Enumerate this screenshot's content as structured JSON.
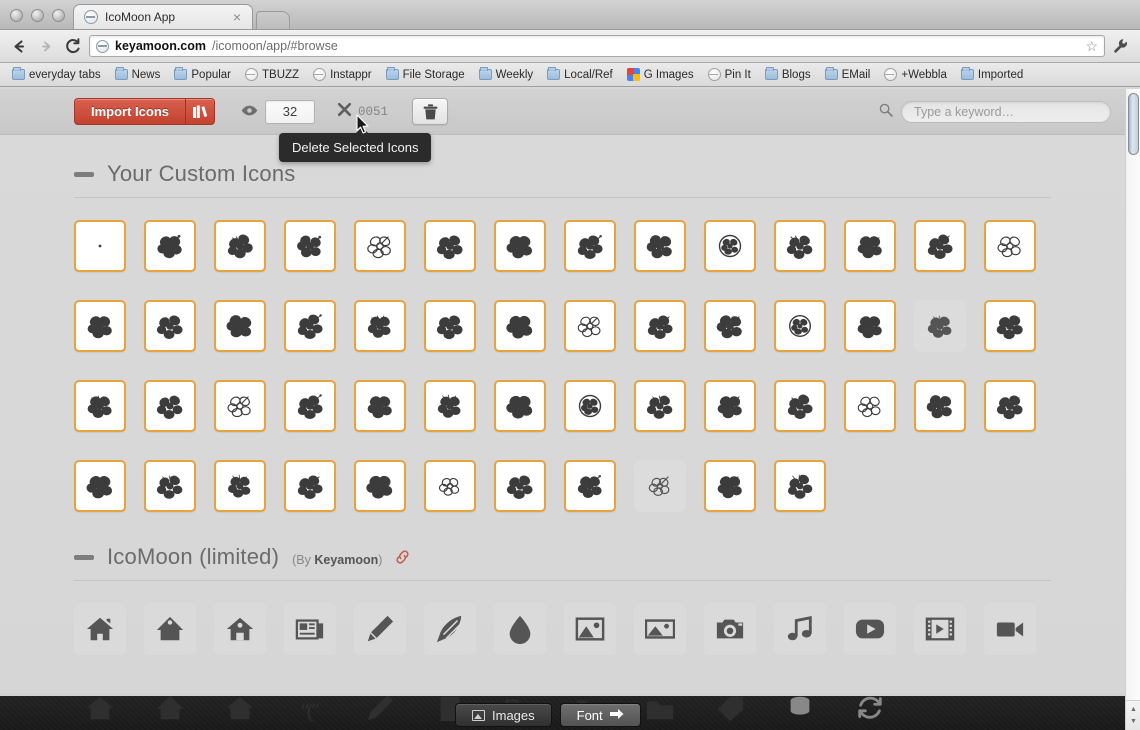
{
  "window": {
    "tab_title": "IcoMoon App",
    "tab_close": "×",
    "traffic_lights": [
      "close",
      "minimize",
      "zoom"
    ]
  },
  "navigation": {
    "back_icon": "←",
    "forward_icon": "→",
    "reload_icon": "C",
    "url_host": "keyamoon.com",
    "url_path": "/icomoon/app/#browse",
    "star_icon": "☆",
    "wrench_icon": "wrench"
  },
  "bookmarks": [
    {
      "label": "everyday tabs",
      "icon": "folder"
    },
    {
      "label": "News",
      "icon": "folder"
    },
    {
      "label": "Popular",
      "icon": "folder"
    },
    {
      "label": "TBUZZ",
      "icon": "globe"
    },
    {
      "label": "Instappr",
      "icon": "globe"
    },
    {
      "label": "File Storage",
      "icon": "folder"
    },
    {
      "label": "Weekly",
      "icon": "folder"
    },
    {
      "label": "Local/Ref",
      "icon": "folder"
    },
    {
      "label": "G Images",
      "icon": "google"
    },
    {
      "label": "Pin It",
      "icon": "globe"
    },
    {
      "label": "Blogs",
      "icon": "folder"
    },
    {
      "label": "EMail",
      "icon": "folder"
    },
    {
      "label": "+Webbla",
      "icon": "globe"
    },
    {
      "label": "Imported",
      "icon": "folder"
    }
  ],
  "toolbar": {
    "import_label": "Import Icons",
    "library_icon": "library-icon",
    "eye_icon": "eye-icon",
    "visible_count": "32",
    "x_icon": "✕",
    "hidden_count": "0051",
    "trash_icon": "trash-icon",
    "search_icon": "search-icon",
    "search_placeholder": "Type a keyword…",
    "search_value": ""
  },
  "tooltip": {
    "text": "Delete Selected Icons"
  },
  "sections": [
    {
      "title": "Your Custom Icons",
      "by": "",
      "author": "",
      "has_link": false,
      "rows": [
        {
          "cells": [
            "dot",
            "hibiscus-a",
            "hibiscus-b",
            "hibiscus-c",
            "hibiscus-outline-a",
            "hibiscus-d",
            "hibiscus-e",
            "hibiscus-f",
            "hibiscus-g",
            "hibiscus-ring",
            "hibiscus-h",
            "hibiscus-i",
            "hibiscus-j",
            "hibiscus-outline-b"
          ],
          "states": [
            "on",
            "on",
            "on",
            "on",
            "on",
            "on",
            "on",
            "on",
            "on",
            "on",
            "on",
            "on",
            "on",
            "on"
          ]
        },
        {
          "cells": [
            "hibiscus-k",
            "hibiscus-l",
            "hibiscus-m",
            "hibiscus-n",
            "hibiscus-o",
            "hibiscus-p",
            "hibiscus-q",
            "hibiscus-outline-c",
            "hibiscus-r",
            "hibiscus-s",
            "hibiscus-ring2",
            "hibiscus-t",
            "hibiscus-u",
            "hibiscus-v"
          ],
          "states": [
            "on",
            "on",
            "on",
            "on",
            "on",
            "on",
            "on",
            "on",
            "on",
            "on",
            "on",
            "on",
            "off",
            "on"
          ]
        },
        {
          "cells": [
            "hibiscus-w",
            "hibiscus-x",
            "hibiscus-outline-d",
            "hibiscus-y",
            "hibiscus-z",
            "hibiscus-aa",
            "hibiscus-ab",
            "hibiscus-ring3",
            "hibiscus-ac",
            "hibiscus-ad",
            "hibiscus-ae",
            "hibiscus-outline-e",
            "hibiscus-af",
            "hibiscus-ag"
          ],
          "states": [
            "on",
            "on",
            "on",
            "on",
            "on",
            "on",
            "on",
            "on",
            "on",
            "on",
            "on",
            "on",
            "on",
            "on"
          ]
        },
        {
          "cells": [
            "hibiscus-ah",
            "hibiscus-ai",
            "hibiscus-aj",
            "hibiscus-ak",
            "hibiscus-al",
            "hibiscus-outline-f",
            "hibiscus-am",
            "hibiscus-an",
            "hibiscus-outline-g",
            "hibiscus-ao",
            "hibiscus-ap"
          ],
          "states": [
            "on",
            "on",
            "on",
            "on",
            "on",
            "on",
            "on",
            "on",
            "off",
            "on",
            "on"
          ]
        }
      ]
    },
    {
      "title": "IcoMoon (limited)",
      "by": "(By ",
      "author": "Keyamoon",
      "by_close": ")",
      "has_link": true,
      "link_icon": "link-icon",
      "rows": [
        {
          "cells": [
            "home-1",
            "home-2",
            "home-3",
            "newspaper",
            "pencil",
            "quill",
            "droplet",
            "image-1",
            "image-2",
            "camera",
            "music",
            "play",
            "film",
            "video-camera"
          ],
          "states": [
            "lib",
            "lib",
            "lib",
            "lib",
            "lib",
            "lib",
            "lib",
            "lib",
            "lib",
            "lib",
            "lib",
            "lib",
            "lib",
            "lib"
          ]
        }
      ]
    }
  ],
  "footer": {
    "images_label": "Images",
    "images_icon": "image-icon",
    "font_label": "Font",
    "font_icon": "arrow-right-icon",
    "cut_icons": [
      "home-1",
      "home-2",
      "home-3",
      "quote",
      "pencil",
      "paper",
      "folder",
      "folder-open",
      "folder-2",
      "tag",
      "database",
      "loop"
    ]
  },
  "scrollbar": {
    "up_arrow": "▲",
    "down_arrow": "▼"
  },
  "colors": {
    "accent_red": "#c4412f",
    "selected_border": "#e8a33d",
    "deselected_bg": "#dcdcdc",
    "page_bg": "#d6d6d6",
    "tooltip_bg": "#2b2b2b"
  }
}
